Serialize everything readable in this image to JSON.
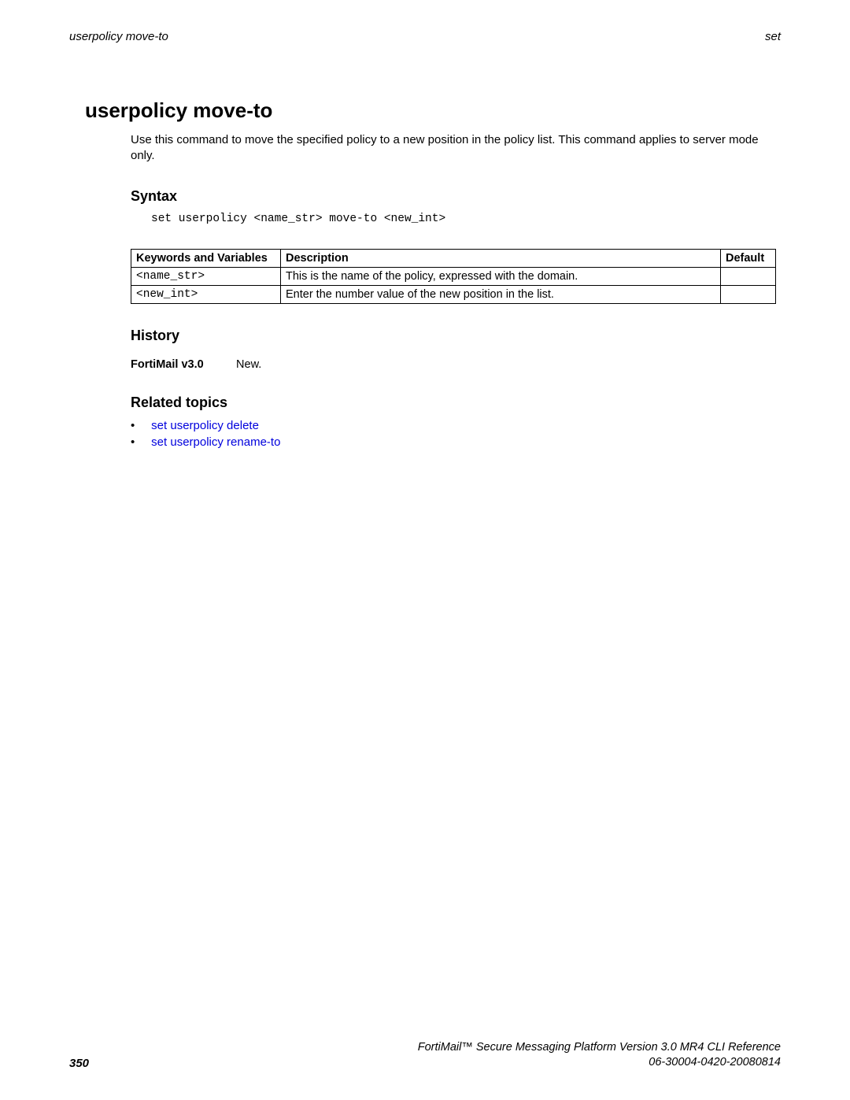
{
  "header": {
    "left": "userpolicy move-to",
    "right": "set"
  },
  "main_title": "userpolicy move-to",
  "intro": "Use this command to move the specified policy to a new position in the policy list. This command applies to server mode only.",
  "syntax": {
    "heading": "Syntax",
    "code": "set userpolicy <name_str> move-to <new_int>"
  },
  "table": {
    "headers": {
      "c1": "Keywords and Variables",
      "c2": "Description",
      "c3": "Default"
    },
    "rows": [
      {
        "c1": "<name_str>",
        "c2": "This is the name of the policy, expressed with the domain.",
        "c3": ""
      },
      {
        "c1": "<new_int>",
        "c2": "Enter the number value of the new position in the list.",
        "c3": ""
      }
    ]
  },
  "history": {
    "heading": "History",
    "version": "FortiMail v3.0",
    "note": "New."
  },
  "related": {
    "heading": "Related topics",
    "items": [
      "set userpolicy delete",
      "set userpolicy rename-to"
    ]
  },
  "footer": {
    "page": "350",
    "line1": "FortiMail™ Secure Messaging Platform Version 3.0 MR4 CLI Reference",
    "line2": "06-30004-0420-20080814"
  }
}
